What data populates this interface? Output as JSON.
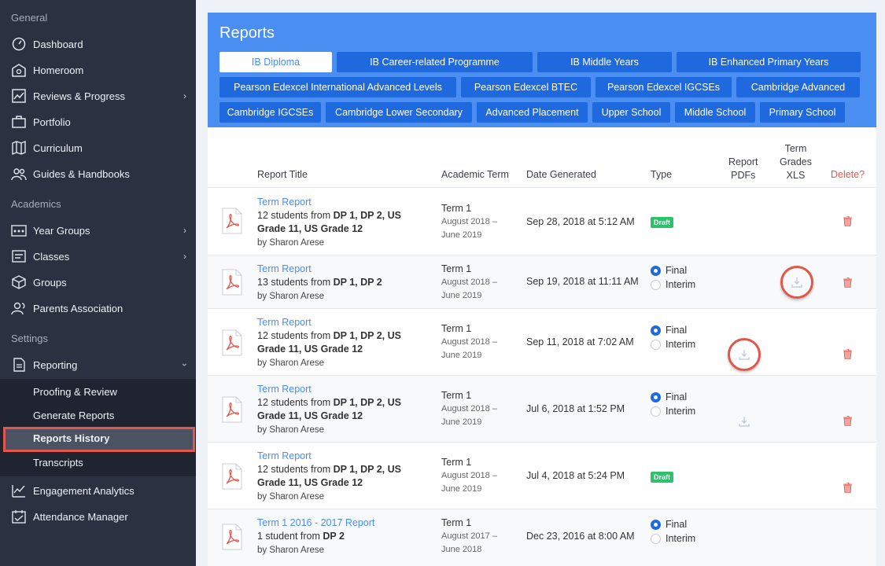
{
  "sidebar": {
    "general_title": "General",
    "general_items": [
      {
        "label": "Dashboard",
        "icon": "dashboard-icon"
      },
      {
        "label": "Homeroom",
        "icon": "homeroom-icon"
      },
      {
        "label": "Reviews & Progress",
        "icon": "chart-icon"
      },
      {
        "label": "Portfolio",
        "icon": "briefcase-icon"
      },
      {
        "label": "Curriculum",
        "icon": "map-icon"
      },
      {
        "label": "Guides & Handbooks",
        "icon": "people-icon"
      }
    ],
    "academics_title": "Academics",
    "academics_items": [
      {
        "label": "Year Groups",
        "icon": "year-groups-icon"
      },
      {
        "label": "Classes",
        "icon": "classes-icon"
      },
      {
        "label": "Groups",
        "icon": "cube-icon"
      },
      {
        "label": "Parents Association",
        "icon": "parents-icon"
      }
    ],
    "settings_title": "Settings",
    "reporting_label": "Reporting",
    "reporting_sub": [
      {
        "label": "Proofing & Review"
      },
      {
        "label": "Generate Reports"
      },
      {
        "label": "Reports History"
      },
      {
        "label": "Transcripts"
      }
    ],
    "bottom_items": [
      {
        "label": "Engagement Analytics",
        "icon": "analytics-icon"
      },
      {
        "label": "Attendance Manager",
        "icon": "attendance-icon"
      }
    ]
  },
  "main": {
    "title": "Reports",
    "tabs": [
      "IB Diploma",
      "IB Career-related Programme",
      "IB Middle Years",
      "IB Enhanced Primary Years",
      "Pearson Edexcel International Advanced Levels",
      "Pearson Edexcel BTEC",
      "Pearson Edexcel IGCSEs",
      "Cambridge Advanced",
      "Cambridge IGCSEs",
      "Cambridge Lower Secondary",
      "Advanced Placement",
      "Upper School",
      "Middle School",
      "Primary School"
    ],
    "columns": {
      "title": "Report Title",
      "term": "Academic Term",
      "date": "Date Generated",
      "type": "Type",
      "pdfs_1": "Report",
      "pdfs_2": "PDFs",
      "xls_1": "Term",
      "xls_2": "Grades",
      "xls_3": "XLS",
      "delete": "Delete?"
    },
    "rows": [
      {
        "link": "Term Report",
        "pre": "12 students from ",
        "bold": "DP 1, DP 2, US Grade 11, US Grade 12",
        "by": "by Sharon Arese",
        "term": "Term 1",
        "range1": "August 2018 –",
        "range2": "June 2019",
        "date": "Sep 28, 2018 at 5:12 AM",
        "type": "Draft"
      },
      {
        "link": "Term Report",
        "pre": "13 students from ",
        "bold": "DP 1, DP 2",
        "by": "by Sharon Arese",
        "term": "Term 1",
        "range1": "August 2018 –",
        "range2": "June 2019",
        "date": "Sep 19, 2018 at 11:11 AM",
        "final": "Final",
        "interim": "Interim"
      },
      {
        "link": "Term Report",
        "pre": "12 students from ",
        "bold": "DP 1, DP 2, US Grade 11, US Grade 12",
        "by": "by Sharon Arese",
        "term": "Term 1",
        "range1": "August 2018 –",
        "range2": "June 2019",
        "date": "Sep 11, 2018 at 7:02 AM",
        "final": "Final",
        "interim": "Interim"
      },
      {
        "link": "Term Report",
        "pre": "12 students from ",
        "bold": "DP 1, DP 2, US Grade 11, US Grade 12",
        "by": "by Sharon Arese",
        "term": "Term 1",
        "range1": "August 2018 –",
        "range2": "June 2019",
        "date": "Jul 6, 2018 at 1:52 PM",
        "final": "Final",
        "interim": "Interim"
      },
      {
        "link": "Term Report",
        "pre": "12 students from ",
        "bold": "DP 1, DP 2, US Grade 11, US Grade 12",
        "by": "by Sharon Arese",
        "term": "Term 1",
        "range1": "August 2018 –",
        "range2": "June 2019",
        "date": "Jul 4, 2018 at 5:24 PM",
        "type": "Draft"
      },
      {
        "link": "Term 1 2016 - 2017 Report",
        "pre": "1 student from ",
        "bold": "DP 2",
        "by": "by Sharon Arese",
        "term": "Term 1",
        "range1": "August 2017 –",
        "range2": "June 2018",
        "date": "Dec 23, 2016 at 8:00 AM",
        "final": "Final",
        "interim": "Interim"
      }
    ]
  },
  "colors": {
    "sidebar": "#2b3140",
    "header": "#4a8ef2",
    "tab": "#1f69df",
    "delete": "#e2574c",
    "draft": "#2cc26b"
  }
}
